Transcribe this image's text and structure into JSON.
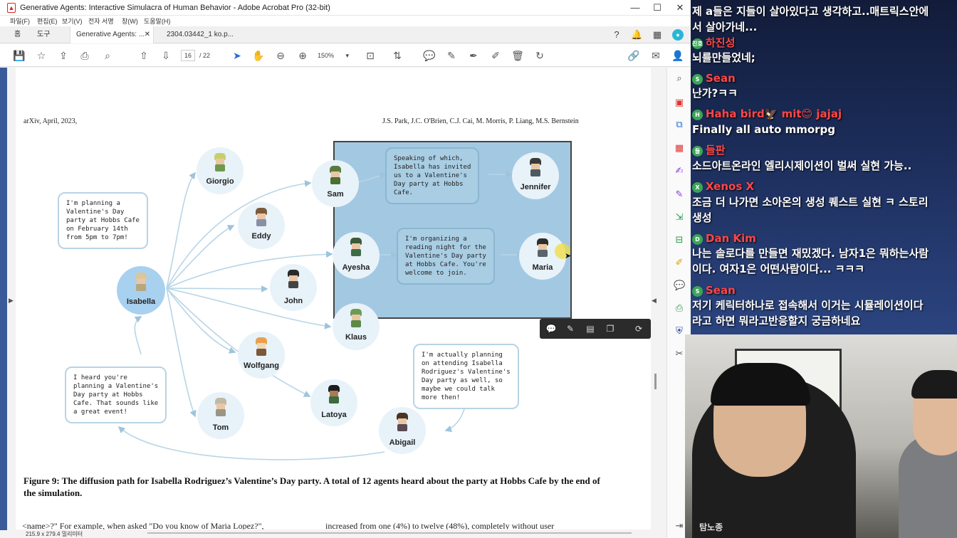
{
  "window": {
    "title": "Generative Agents: Interactive Simulacra of Human Behavior - Adobe Acrobat Pro (32-bit)",
    "controls": {
      "minimize": "—",
      "maximize": "☐",
      "close": "✕"
    }
  },
  "menu": [
    "파일(F)",
    "편집(E)",
    "보기(V)",
    "전자 서명",
    "창(W)",
    "도움말(H)"
  ],
  "tabs": {
    "home": "홈",
    "tools": "도구",
    "doc_tab": "Generative Agents: ...",
    "doc_tab2": "2304.03442_1 ko.p..."
  },
  "toolbar": {
    "page_current": "16",
    "page_total": "/ 22",
    "zoom": "150%"
  },
  "paper": {
    "header_left": "arXiv, April, 2023,",
    "header_right": "J.S. Park, J.C. O'Brien, C.J. Cai, M. Morris, P. Liang, M.S. Bernstein",
    "caption": "Figure 9: The diffusion path for Isabella Rodriguez’s Valentine’s Day party. A total of 12 agents heard about the party at Hobbs Cafe by the end of the simulation.",
    "body_left": "<name>?\" For example, when asked \"Do you know of Maria Lopez?\",",
    "body_right": "increased from one (4%) to twelve (48%), completely without user"
  },
  "figure": {
    "agents": [
      "Giorgio",
      "Sam",
      "Jennifer",
      "Eddy",
      "Ayesha",
      "Maria",
      "Isabella",
      "John",
      "Klaus",
      "Wolfgang",
      "Latoya",
      "Tom",
      "Abigail"
    ],
    "bubbles": {
      "isabella": "I'm planning a\nValentine's Day\nparty at Hobbs Cafe\non February 14th\nfrom 5pm to 7pm!",
      "sam": "Speaking of which,\nIsabella has invited\nus to a Valentine's\nDay party at Hobbs\nCafe.",
      "ayesha": "I'm organizing a\nreading night for the\nValentine's Day party\nat Hobbs Cafe. You're\nwelcome to join.",
      "abigail": "I'm actually planning\non attending Isabella\nRodriguez's Valentine's\nDay party as well, so\nmaybe we could talk\nmore then!",
      "tom": "I heard you're\nplanning a Valentine's\nDay party at Hobbs\nCafe. That sounds like\na great event!"
    }
  },
  "status": {
    "size": "215.9 x 279.4 밀리미터"
  },
  "chat": {
    "lines": [
      {
        "type": "msg",
        "text": "제 a들은 지들이 살아있다고 생각하고..매트릭스안에"
      },
      {
        "type": "msg",
        "text": "서 살아가네..."
      },
      {
        "type": "nick",
        "badge": "진호",
        "name": "하진성",
        "color": "#ff4747"
      },
      {
        "type": "msg",
        "text": "뇌를만들었네;"
      },
      {
        "type": "nick",
        "badge": "S",
        "name": "Sean",
        "color": "#ff4747"
      },
      {
        "type": "msg",
        "text": "난가?ㅋㅋ"
      },
      {
        "type": "nick",
        "badge": "H",
        "name": "Haha bird🦅 mit😊 jajaj",
        "color": "#ff4747"
      },
      {
        "type": "msg",
        "text": "Finally all auto mmorpg"
      },
      {
        "type": "nick",
        "badge": "들",
        "name": "들판",
        "color": "#ff4747"
      },
      {
        "type": "msg",
        "text": "소드아트온라인 엘리시제이션이 벌써 실현 가능.."
      },
      {
        "type": "nick",
        "badge": "X",
        "name": "Xenos X",
        "color": "#ff4747"
      },
      {
        "type": "msg",
        "text": "조금 더 나가면 소아온의 생성 퀘스트 실현 ㅋ 스토리"
      },
      {
        "type": "msg",
        "text": "생성"
      },
      {
        "type": "nick",
        "badge": "D",
        "name": "Dan Kim",
        "color": "#ff4747"
      },
      {
        "type": "msg",
        "text": "나는 솔로다를 만들면 재밌겠다. 남자1은 뭐하는사람"
      },
      {
        "type": "msg",
        "text": "이다. 여자1은 어떤사람이다... ㅋㅋㅋ"
      },
      {
        "type": "nick",
        "badge": "S",
        "name": "Sean",
        "color": "#ff4747"
      },
      {
        "type": "msg",
        "text": "저기 케릭터하나로 접속해서 이거는 시뮬레이션이다"
      },
      {
        "type": "msg",
        "text": "라고 하면 뭐라고반응할지 궁금하네요"
      }
    ]
  },
  "cam": {
    "shirt_text": "탐노종"
  }
}
